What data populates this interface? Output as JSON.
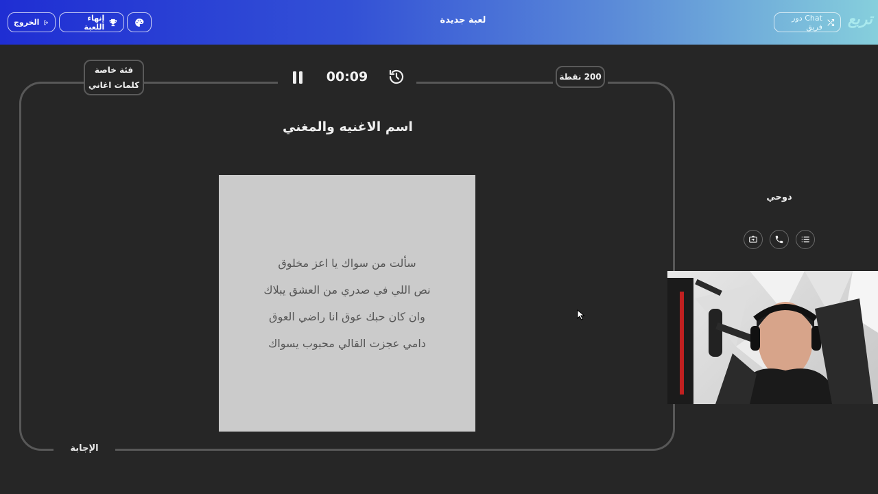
{
  "header": {
    "logo": "تربع",
    "chat_label": "Chat دور فريق",
    "title": "لعبة جديدة",
    "end_game_label": "إنهاء اللعبة",
    "exit_label": "الخروج"
  },
  "board": {
    "category_line1": "فئة خاصة",
    "category_line2": "كلمات اغاني",
    "points": "200 نقطة",
    "timer": "00:09",
    "question": "اسم الاغنيه والمغني",
    "lyrics": [
      "سألت من سواك يا اعز مخلوق",
      "نص اللي في صدري من العشق يبلاك",
      "وان كان حبك عوق انا راضي العوق",
      "دامي عجزت القالي محبوب يسواك"
    ],
    "answer_label": "الإجابة"
  },
  "player": {
    "name": "دوحي"
  },
  "colors": {
    "background": "#262626",
    "header_start": "#1f2ed3",
    "header_end": "#86cfdc",
    "card": "#cbcbcb"
  }
}
